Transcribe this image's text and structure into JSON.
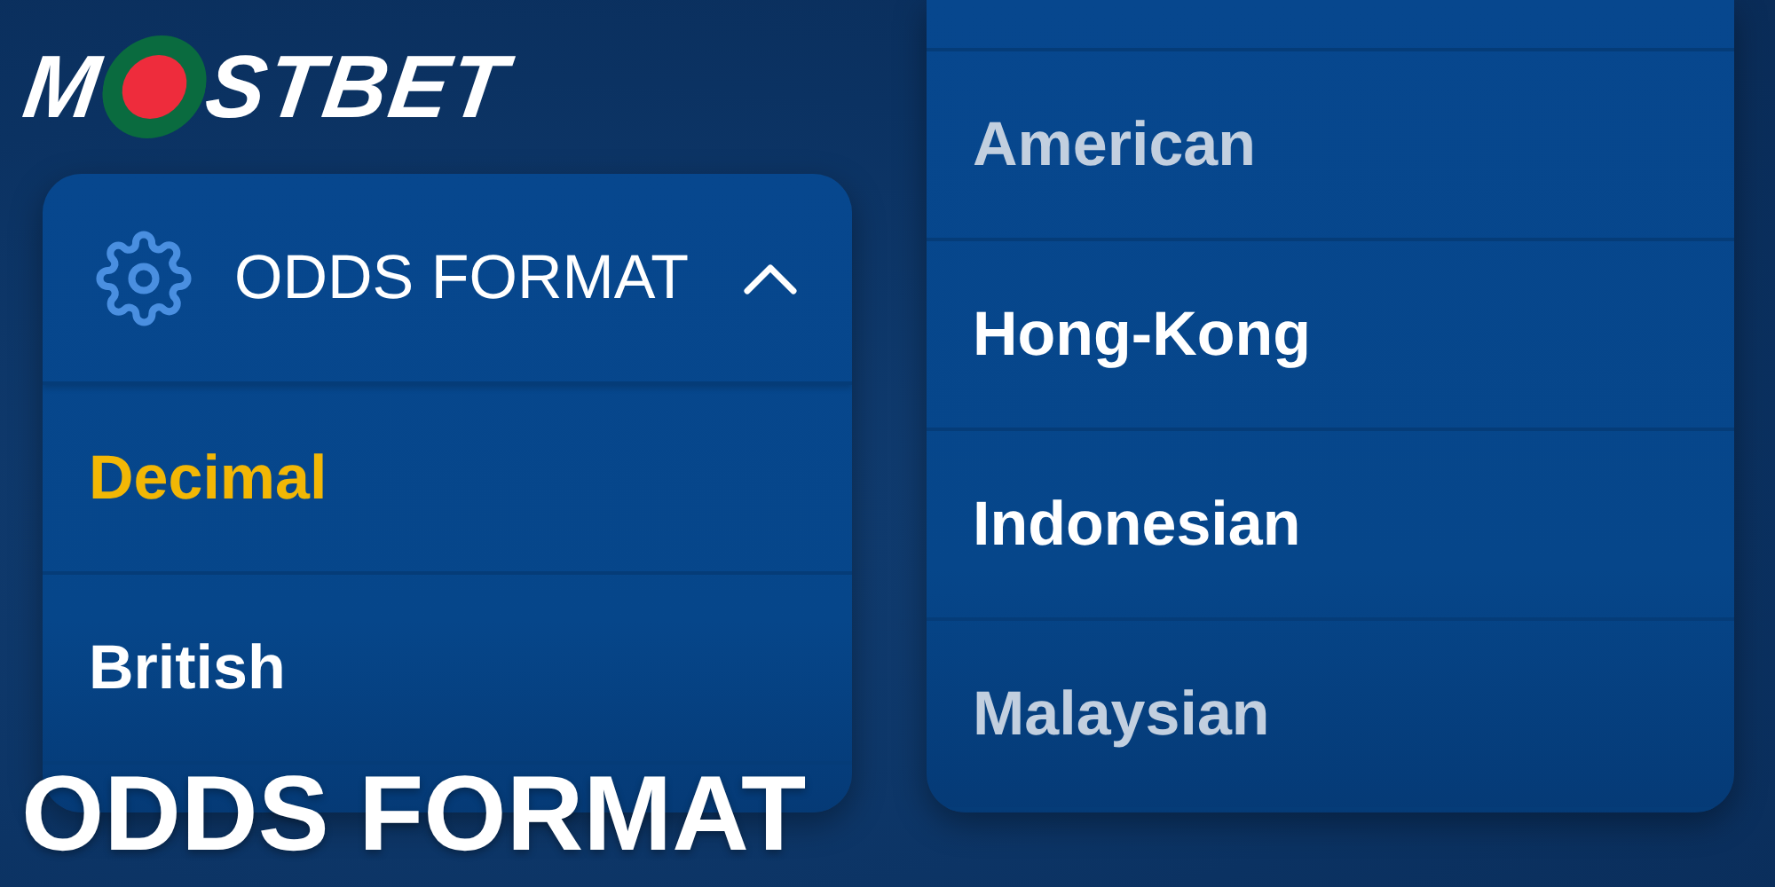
{
  "logo": {
    "before": "M",
    "after": "STBET"
  },
  "menu": {
    "title": "ODDS FORMAT",
    "expanded": true,
    "items": [
      {
        "label": "Decimal",
        "selected": true,
        "faded": false
      },
      {
        "label": "British",
        "selected": false,
        "faded": false
      }
    ]
  },
  "picker": {
    "items": [
      {
        "label": "American",
        "selected": false,
        "faded": true
      },
      {
        "label": "Hong-Kong",
        "selected": false,
        "faded": false
      },
      {
        "label": "Indonesian",
        "selected": false,
        "faded": false
      },
      {
        "label": "Malaysian",
        "selected": false,
        "faded": true
      }
    ]
  },
  "caption": "ODDS FORMAT"
}
